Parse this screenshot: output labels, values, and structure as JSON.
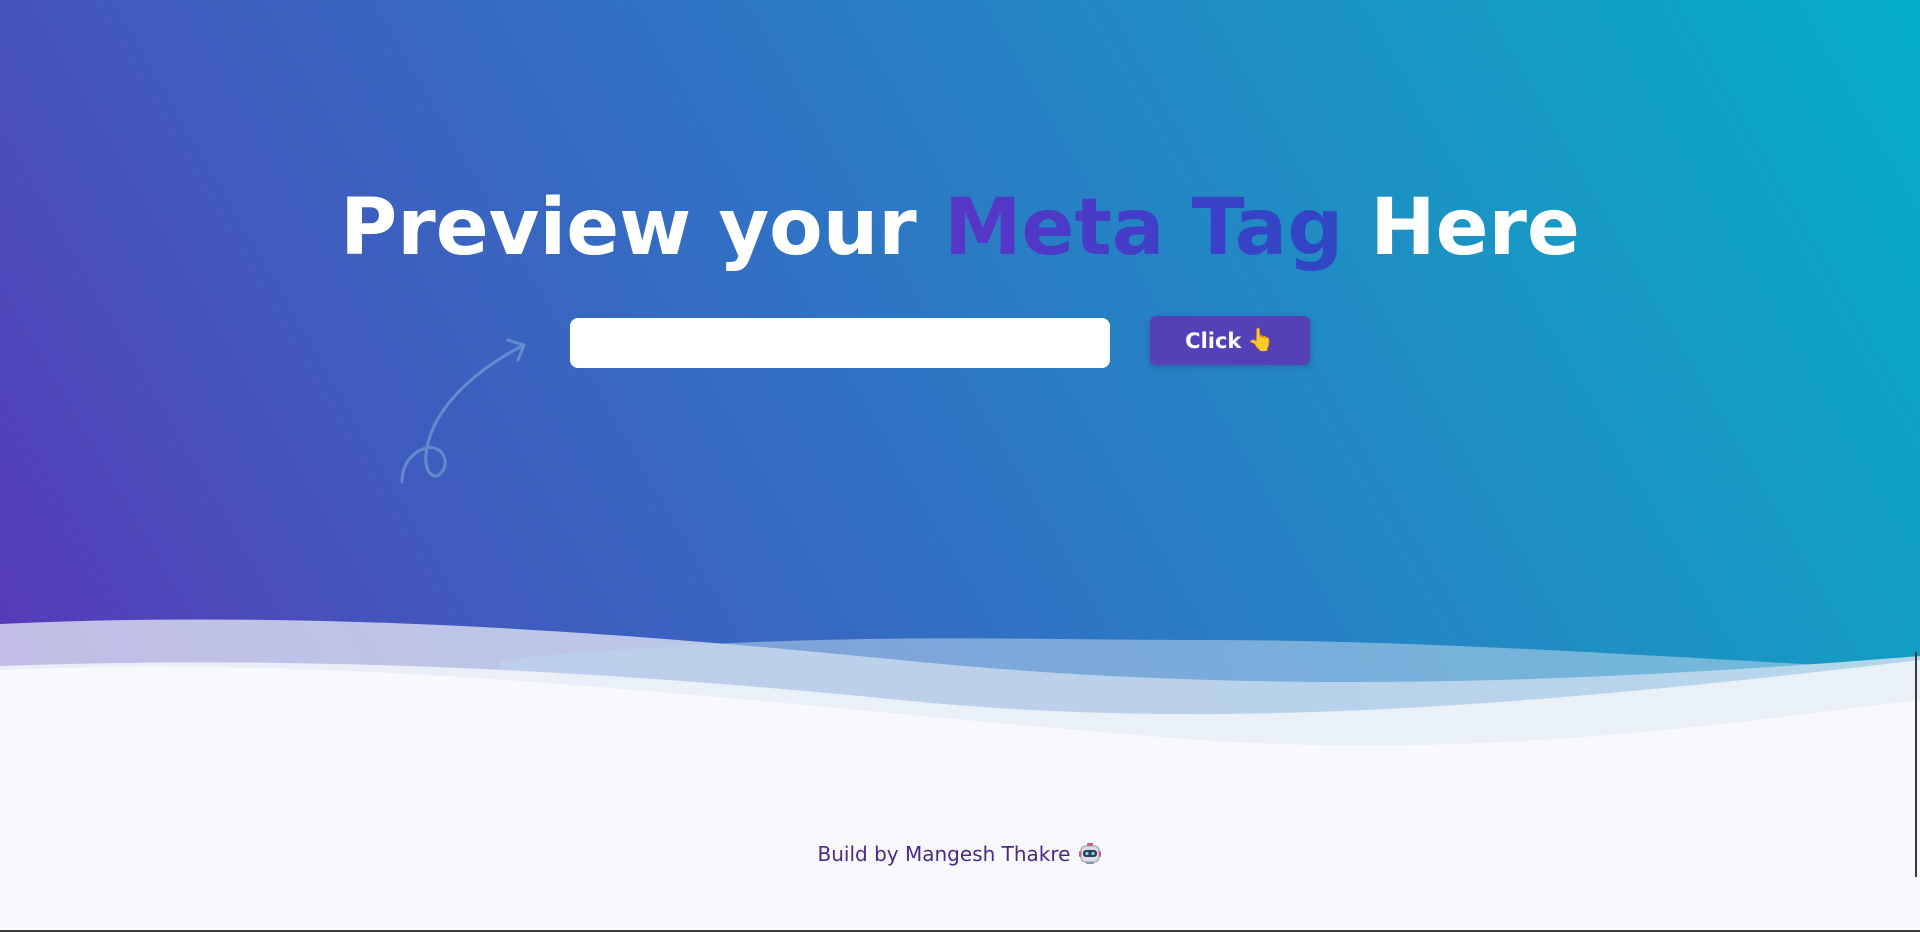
{
  "hero": {
    "headline_prefix": "Preview your ",
    "headline_accent": "Meta Tag",
    "headline_suffix": " Here"
  },
  "form": {
    "url_value": "",
    "url_placeholder": "",
    "button_label": "Click",
    "button_icon": "pointing-hand-emoji",
    "button_icon_glyph": "👆"
  },
  "footer": {
    "credit": "Build by Mangesh Thakre",
    "icon": "robot-emoji"
  },
  "colors": {
    "gradient_start": "#5a35b8",
    "gradient_end": "#05aec8",
    "accent_text": "#4a3dc6",
    "button_bg": "#5640b8",
    "footer_text": "#4b2a86",
    "page_bg": "#f8f9fc"
  }
}
